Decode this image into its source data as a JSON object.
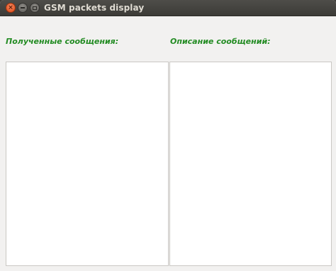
{
  "window": {
    "title": "GSM packets display",
    "controls": {
      "close_glyph": "×"
    }
  },
  "received": {
    "label": "Полученные сообщения:",
    "items": []
  },
  "description": {
    "label": "Описание сообщений:",
    "text": ""
  },
  "colors": {
    "label_green": "#228b22",
    "titlebar": "#3c3b37",
    "close_button": "#df4a16",
    "window_bg": "#f2f1f0"
  }
}
